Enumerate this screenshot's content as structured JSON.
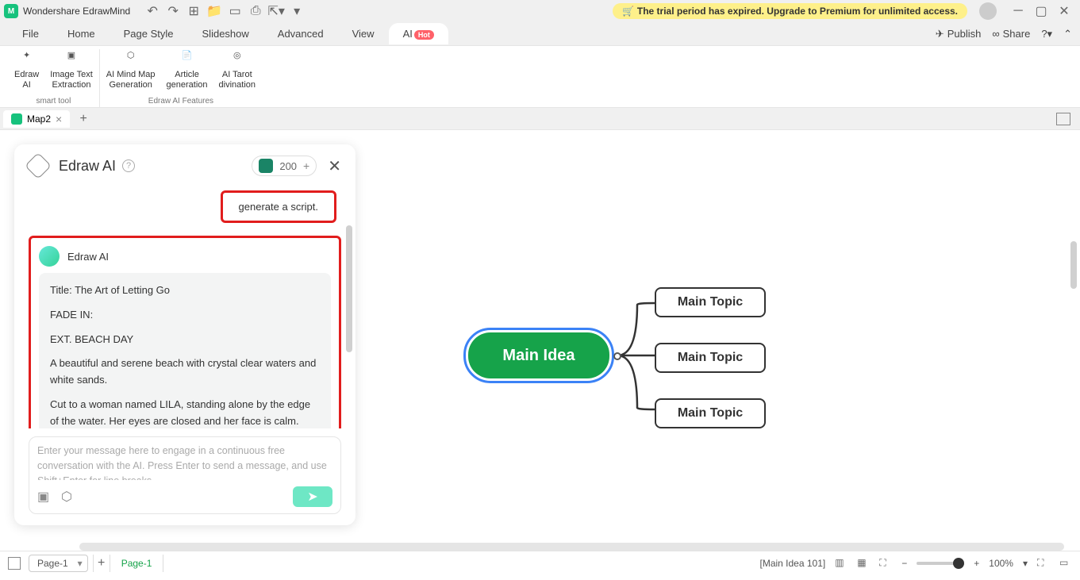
{
  "app": {
    "title": "Wondershare EdrawMind"
  },
  "trial_banner": "The trial period has expired. Upgrade to Premium for unlimited access.",
  "menu": {
    "items": [
      "File",
      "Home",
      "Page Style",
      "Slideshow",
      "Advanced",
      "View"
    ],
    "ai_label": "AI",
    "hot": "Hot",
    "publish": "Publish",
    "share": "Share"
  },
  "ribbon": {
    "group1": {
      "btn1": "Edraw\nAI",
      "btn2": "Image Text\nExtraction",
      "label": "smart tool"
    },
    "group2": {
      "btn1": "AI Mind Map\nGeneration",
      "btn2": "Article\ngeneration",
      "btn3": "AI Tarot\ndivination",
      "label": "Edraw AI Features"
    }
  },
  "doctab": {
    "name": "Map2"
  },
  "ai_panel": {
    "title": "Edraw AI",
    "count": "200",
    "user_msg": "generate a script.",
    "bot_name": "Edraw AI",
    "resp": {
      "l1": "Title: The Art of Letting Go",
      "l2": "FADE IN:",
      "l3": "EXT. BEACH  DAY",
      "l4": "A beautiful and serene beach with crystal clear waters and white sands.",
      "l5": "Cut to a woman named LILA, standing alone by the edge of the water. Her eyes are closed and her face is calm."
    },
    "placeholder": "Enter your message here to engage in a continuous free conversation with the AI. Press Enter to send a message, and use Shift+Enter for line breaks"
  },
  "mindmap": {
    "main": "Main Idea",
    "topic": "Main Topic"
  },
  "status": {
    "page_dd": "Page-1",
    "page_tab": "Page-1",
    "info": "[Main Idea 101]",
    "zoom": "100%"
  }
}
